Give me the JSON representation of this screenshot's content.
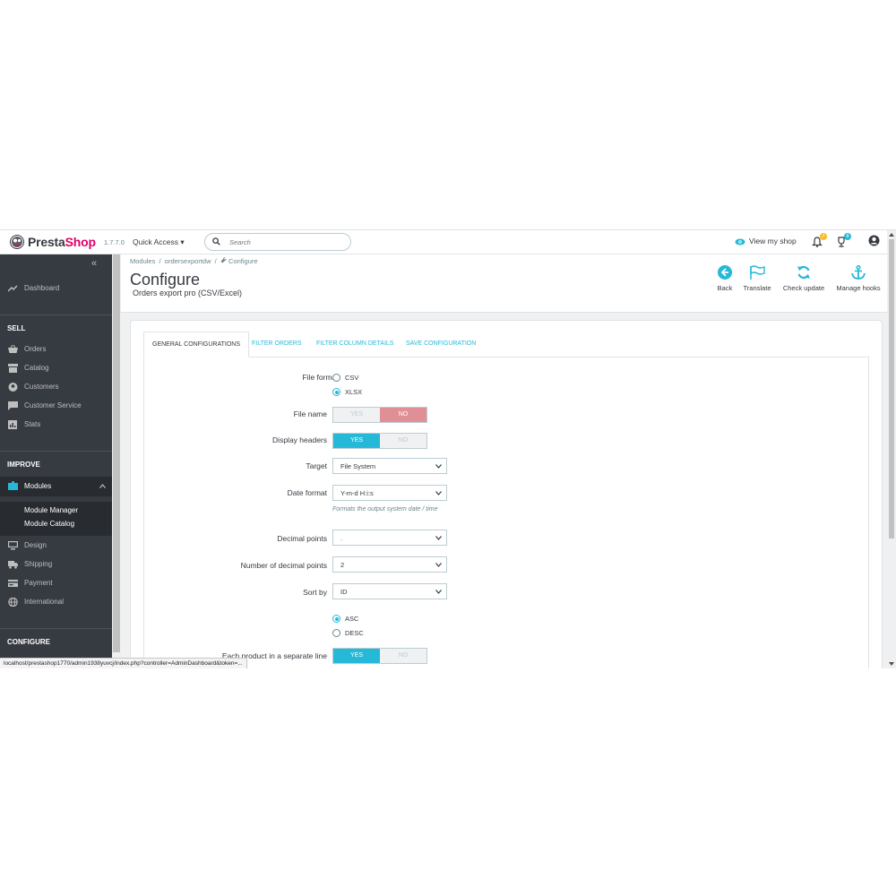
{
  "header": {
    "brand_presta": "Presta",
    "brand_shop": "Shop",
    "version": "1.7.7.0",
    "quick_access": "Quick Access ▾",
    "search_placeholder": "Search",
    "view_shop": "View my shop",
    "notif_badge_orders": "7",
    "notif_badge_customers": "8"
  },
  "sidebar": {
    "collapse": "«",
    "dashboard": "Dashboard",
    "sections": {
      "sell": "SELL",
      "improve": "IMPROVE",
      "configure": "CONFIGURE"
    },
    "sell_items": [
      "Orders",
      "Catalog",
      "Customers",
      "Customer Service",
      "Stats"
    ],
    "improve_items": [
      "Modules",
      "Design",
      "Shipping",
      "Payment",
      "International"
    ],
    "module_sub": [
      "Module Manager",
      "Module Catalog"
    ]
  },
  "breadcrumb": {
    "modules": "Modules",
    "module": "ordersexportdw",
    "configure": "Configure",
    "sep": "/"
  },
  "page": {
    "title": "Configure",
    "subtitle": "Orders export pro (CSV/Excel)"
  },
  "toolbar": {
    "back": "Back",
    "translate": "Translate",
    "check_update": "Check update",
    "manage_hooks": "Manage hooks"
  },
  "tabs": [
    "GENERAL CONFIGURATIONS",
    "FILTER ORDERS",
    "FILTER COLUMN DETAILS",
    "SAVE CONFIGURATION"
  ],
  "form": {
    "file_format": {
      "label": "File format:",
      "options": [
        "CSV",
        "XLSX"
      ],
      "selected": "XLSX"
    },
    "file_name": {
      "label": "File name",
      "yes": "YES",
      "no": "NO",
      "value": "NO"
    },
    "display_headers": {
      "label": "Display headers",
      "yes": "YES",
      "no": "NO",
      "value": "YES"
    },
    "target": {
      "label": "Target",
      "value": "File System"
    },
    "date_format": {
      "label": "Date format",
      "value": "Y-m-d H:i:s",
      "help": "Formats the output system date / time"
    },
    "decimal_points": {
      "label": "Decimal points",
      "value": "."
    },
    "num_decimal_points": {
      "label": "Number of decimal points",
      "value": "2"
    },
    "sort_by": {
      "label": "Sort by",
      "value": "ID"
    },
    "sort_order": {
      "options": [
        "ASC",
        "DESC"
      ],
      "selected": "ASC"
    },
    "each_product": {
      "label": "Each product in a separate line",
      "yes": "YES",
      "no": "NO",
      "value": "YES"
    }
  },
  "statusbar": "localhost/prestashop1770/admin1938yuvcj/index.php?controller=AdminDashboard&token=...",
  "colors": {
    "accent": "#25b9d7",
    "sidebar": "#363a41",
    "no_active": "#e08f95",
    "brand_pink": "#df0067"
  }
}
